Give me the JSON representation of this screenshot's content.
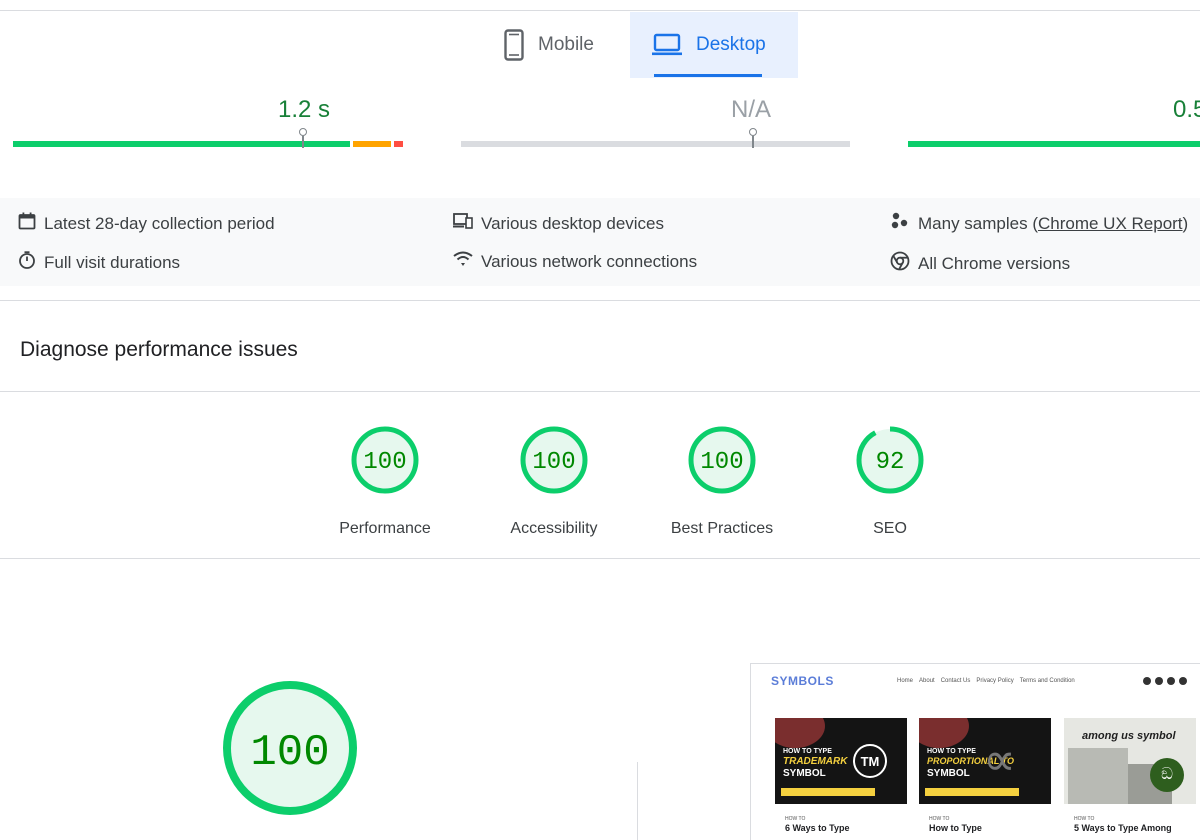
{
  "tabs": [
    {
      "label": "Mobile",
      "icon": "phone-icon",
      "selected": false
    },
    {
      "label": "Desktop",
      "icon": "laptop-icon",
      "selected": true
    }
  ],
  "metrics": [
    {
      "value": "1.2 s",
      "color": "#188038"
    },
    {
      "value": "N/A",
      "color": "#9aa0a6"
    },
    {
      "value": "0.5",
      "color": "#188038"
    }
  ],
  "info": {
    "collection_period": "Latest 28-day collection period",
    "devices": "Various desktop devices",
    "samples_prefix": "Many samples (",
    "samples_link": "Chrome UX Report",
    "samples_suffix": ")",
    "visit_durations": "Full visit durations",
    "network": "Various network connections",
    "chrome_versions": "All Chrome versions"
  },
  "section_title": "Diagnose performance issues",
  "scores": [
    {
      "value": "100",
      "label": "Performance",
      "fraction": 1.0
    },
    {
      "value": "100",
      "label": "Accessibility",
      "fraction": 1.0
    },
    {
      "value": "100",
      "label": "Best Practices",
      "fraction": 1.0
    },
    {
      "value": "92",
      "label": "SEO",
      "fraction": 0.92
    }
  ],
  "main_score": {
    "value": "100",
    "fraction": 1.0
  },
  "colors": {
    "good": "#0cce6b",
    "good_text": "#008800",
    "good_fill": "#e6f8ee",
    "average": "#ffa400",
    "poor": "#ff4e42",
    "accent": "#1a73e8"
  },
  "thumbnail": {
    "logo": "SYMBOLS",
    "nav": [
      "Home",
      "About",
      "Contact Us",
      "Privacy Policy",
      "Terms and Condition"
    ],
    "cards": [
      {
        "kicker": "HOW TO TYPE",
        "title_line1": "TRADEMARK",
        "title_line2": "SYMBOL",
        "glyph": "TM",
        "category": "HOW TO",
        "caption": "6 Ways to Type"
      },
      {
        "kicker": "HOW TO TYPE",
        "title_line1": "PROPORTIONAL TO",
        "title_line2": "SYMBOL",
        "glyph": "∝",
        "category": "HOW TO",
        "caption": "How to Type"
      },
      {
        "kicker": "",
        "title_line1": "among us symbol",
        "title_line2": "",
        "glyph": "ඞ",
        "category": "HOW TO",
        "caption": "5 Ways to Type Among"
      }
    ]
  }
}
